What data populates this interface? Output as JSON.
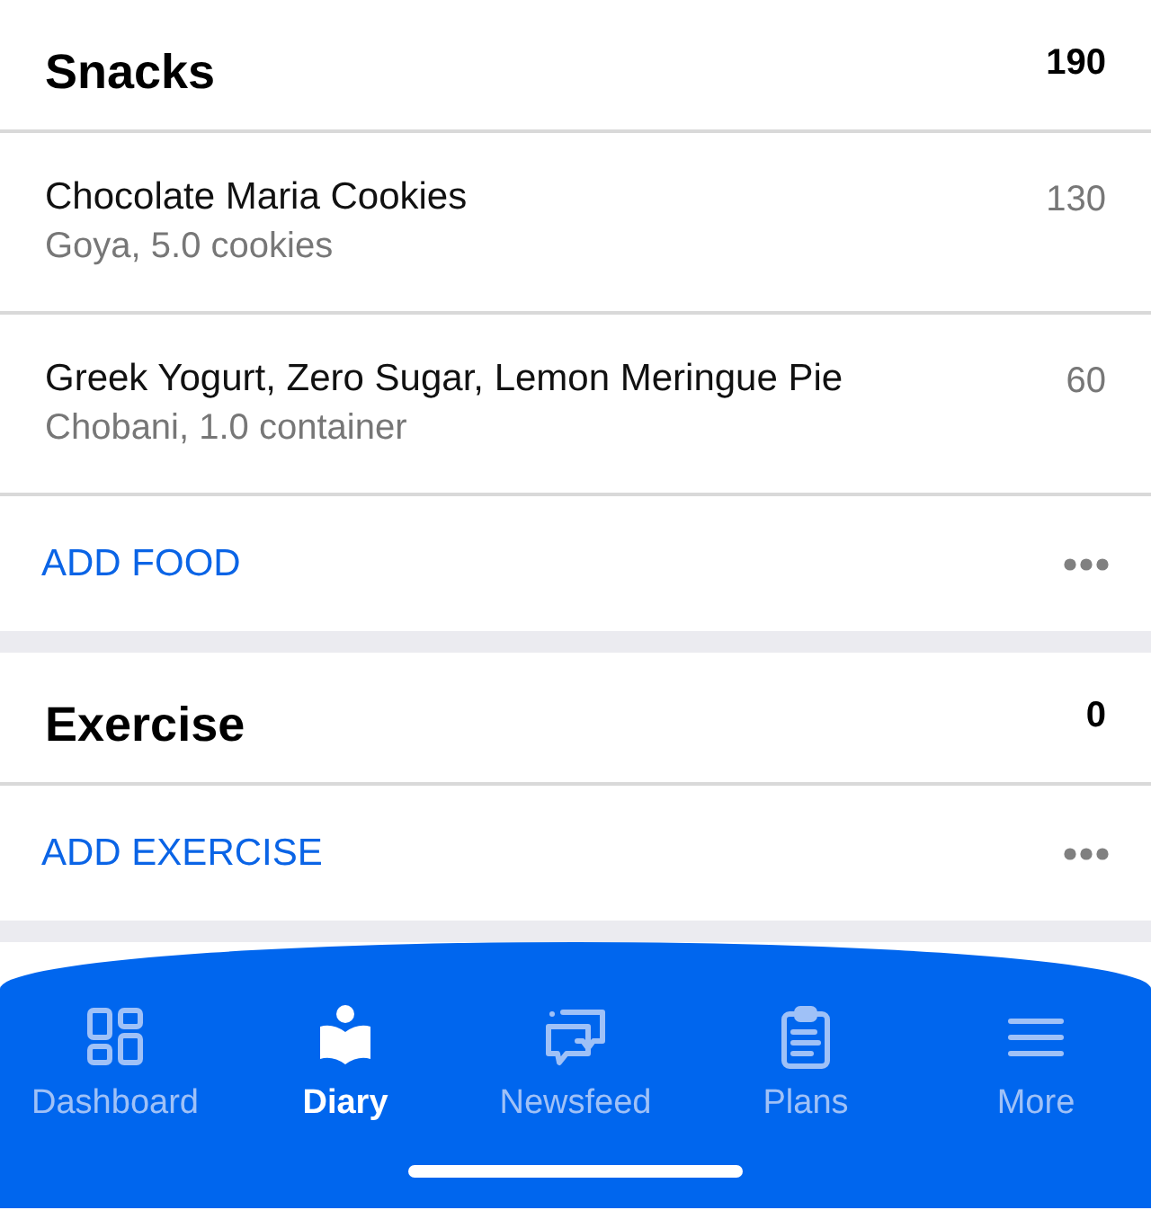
{
  "sections": [
    {
      "title": "Snacks",
      "total": "190",
      "items": [
        {
          "name": "Chocolate Maria Cookies",
          "detail": "Goya, 5.0 cookies",
          "calories": "130"
        },
        {
          "name": "Greek Yogurt, Zero Sugar, Lemon Meringue Pie",
          "detail": "Chobani, 1.0 container",
          "calories": "60"
        }
      ],
      "action": "ADD FOOD"
    },
    {
      "title": "Exercise",
      "total": "0",
      "action": "ADD EXERCISE"
    }
  ],
  "tab_bar": [
    {
      "label": "Dashboard",
      "kind": "dashboard",
      "selected": false
    },
    {
      "label": "Diary",
      "kind": "diary",
      "selected": true
    },
    {
      "label": "Newsfeed",
      "kind": "newsfeed",
      "selected": false
    },
    {
      "label": "Plans",
      "kind": "plans",
      "selected": false
    },
    {
      "label": "More",
      "kind": "more",
      "selected": false
    }
  ]
}
